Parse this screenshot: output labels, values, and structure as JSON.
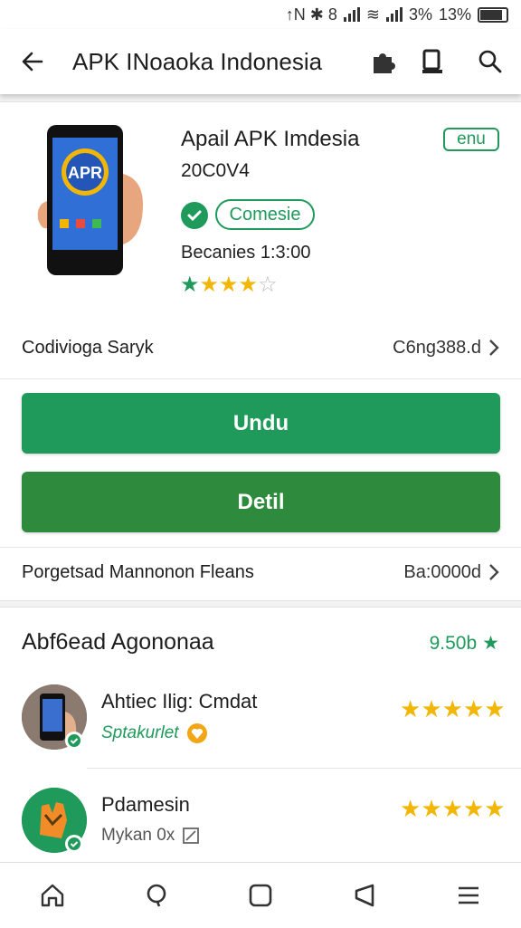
{
  "status_bar": {
    "icons_text": "↑N ✱ 8",
    "sim2": "3%",
    "battery": "13%"
  },
  "app_bar": {
    "title": "APK INoaoka Indonesia",
    "back_icon": "arrow-left-icon",
    "actions": [
      "puzzle-icon",
      "book-icon",
      "search-icon"
    ]
  },
  "app_info": {
    "name": "Apail APK Imdesia",
    "version": "20C0V4",
    "tag": "enu",
    "verified_label": "Comesie",
    "downloads": "Becanies 1:3:00",
    "rating": 4
  },
  "developer_row": {
    "label": "Codivioga Saryk",
    "value": "C6ng388.d"
  },
  "buttons": {
    "primary": "Undu",
    "secondary": "Detil"
  },
  "info_row": {
    "label": "Porgetsad Mannonon Fleans",
    "value": "Ba:0000d"
  },
  "reviews": {
    "header": "Abf6ead Agononaa",
    "score": "9.50b",
    "items": [
      {
        "name": "Ahtiec Ilig: Cmdat",
        "meta": "Sptakurlet",
        "rating": 5
      },
      {
        "name": "Pdamesin",
        "meta": "Mykan 0x",
        "rating": 5
      }
    ]
  },
  "nav_bar": {
    "items": [
      "home-icon",
      "chat-icon",
      "square-icon",
      "back-triangle-icon",
      "menu-icon"
    ]
  },
  "colors": {
    "primary_green": "#1f9a5b",
    "secondary_green": "#2e8b3d",
    "star": "#f2b705"
  }
}
